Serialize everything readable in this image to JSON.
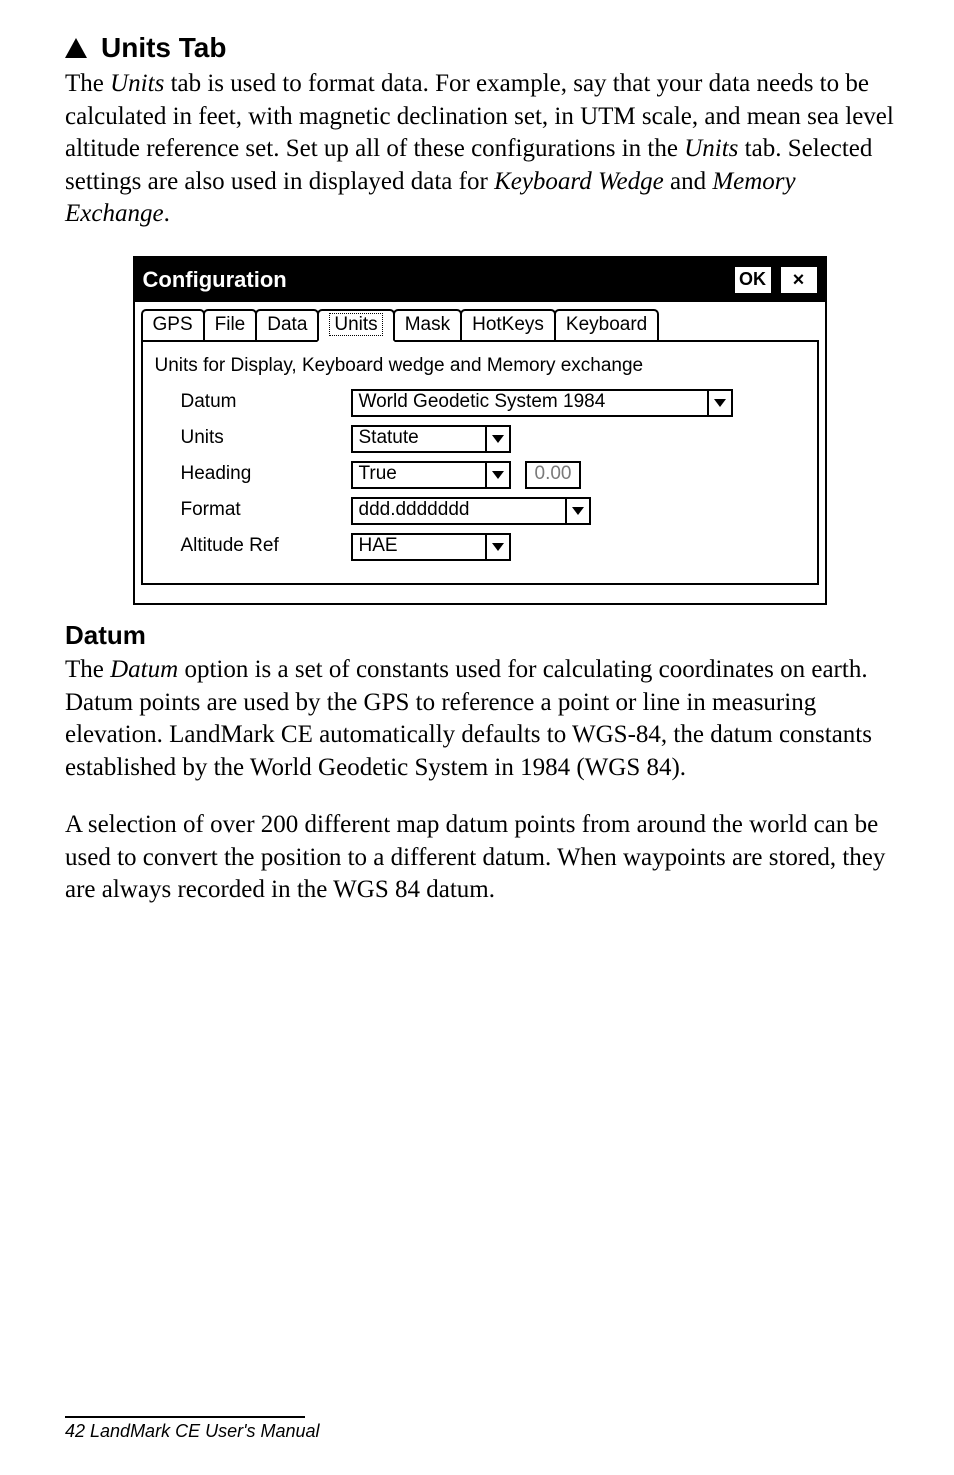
{
  "heading": {
    "marker_icon": "up-triangle-icon",
    "title": "Units Tab"
  },
  "intro_html": "The <i>Units</i> tab is used to format data. For example, say that your data needs to be calculated in feet, with magnetic declination set, in UTM scale, and mean sea level altitude reference set. Set up all of these configurations in the <i>Units</i> tab. Selected settings are also used in displayed data for <i>Keyboard Wedge</i> and <i>Memory Exchange</i>.",
  "dialog": {
    "title": "Configuration",
    "ok_label": "OK",
    "close_label": "×",
    "tabs": {
      "gps": "GPS",
      "file": "File",
      "data": "Data",
      "units": "Units",
      "mask": "Mask",
      "hotkeys": "HotKeys",
      "keyboard": "Keyboard",
      "active": "Units"
    },
    "desc": "Units for Display, Keyboard wedge and Memory exchange",
    "labels": {
      "datum": "Datum",
      "units": "Units",
      "heading": "Heading",
      "format": "Format",
      "altitude_ref": "Altitude Ref"
    },
    "values": {
      "datum": "World Geodetic System 1984",
      "units": "Statute",
      "heading": "True",
      "heading_offset": "0.00",
      "format": "ddd.ddddddd",
      "altitude_ref": "HAE"
    }
  },
  "datum_heading": "Datum",
  "datum_p1_html": "The <i>Datum</i> option is a set of constants used for calculating coordinates on earth. Datum points are used by the GPS to reference a point or line in measuring elevation. LandMark CE automatically defaults to WGS-84, the datum constants established by the World Geodetic System in 1984 (WGS 84).",
  "datum_p2": "A selection of over 200 different map datum points from around the world can be used to convert the position to a different datum. When waypoints are stored, they are always recorded in the WGS 84 datum.",
  "footer": "42  LandMark CE User's Manual"
}
